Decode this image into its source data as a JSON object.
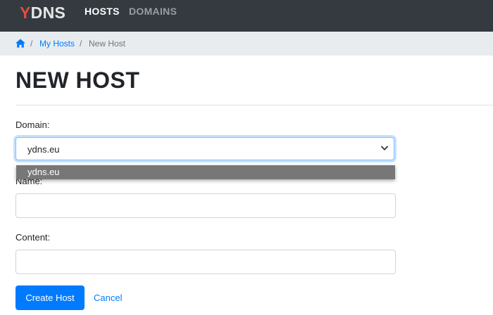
{
  "navbar": {
    "brand_first": "Y",
    "brand_rest": "DNS",
    "links": [
      {
        "label": "HOSTS",
        "active": true
      },
      {
        "label": "DOMAINS",
        "active": false
      }
    ]
  },
  "breadcrumb": {
    "home_icon": "home-icon",
    "items": [
      "My Hosts",
      "New Host"
    ],
    "separator": "/"
  },
  "page": {
    "title": "NEW HOST"
  },
  "form": {
    "domain": {
      "label": "Domain:",
      "selected": "ydns.eu",
      "options": [
        "ydns.eu"
      ]
    },
    "name": {
      "label": "Name:",
      "value": ""
    },
    "content": {
      "label": "Content:",
      "value": ""
    },
    "submit_label": "Create Host",
    "cancel_label": "Cancel"
  },
  "colors": {
    "navbar": "#343a40",
    "brand_accent": "#e44b3d",
    "primary": "#007bff",
    "breadcrumb_bg": "#e9ecef"
  }
}
